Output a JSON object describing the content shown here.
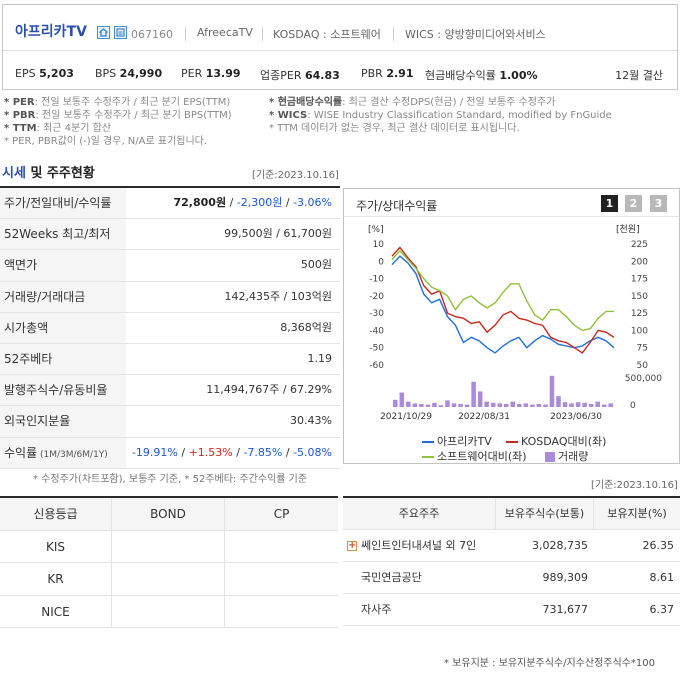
{
  "company": {
    "name": "아프리카TV",
    "code": "067160",
    "exchange_name": "AfreecaTV",
    "market": "KOSDAQ : 소프트웨어",
    "wics": "WICS : 양방향미디어와서비스"
  },
  "summary": {
    "stats": [
      {
        "label": "EPS",
        "value": "5,203"
      },
      {
        "label": "BPS",
        "value": "24,990"
      },
      {
        "label": "PER",
        "value": "13.99"
      },
      {
        "label": "업종PER",
        "value": "64.83"
      },
      {
        "label": "PBR",
        "value": "2.91"
      },
      {
        "label": "현금배당수익률",
        "value": "1.00%"
      }
    ],
    "settlement": "12월 결산"
  },
  "notes": [
    {
      "key": "* PER",
      "text": ": 전일 보통주 수정주가 / 최근 분기 EPS(TTM)"
    },
    {
      "key": "* PBR",
      "text": ": 전일 보통주 수정주가 / 최근 분기 BPS(TTM)"
    },
    {
      "key": "* TTM",
      "text": ": 최근 4분기 합산"
    },
    {
      "key": "",
      "text": "* PER, PBR값이 (-)일 경우, N/A로 표기됩니다."
    },
    {
      "key": "* 현금배당수익률",
      "text": ": 최근 결산 수정DPS(현금) / 전일 보통주 수정주가"
    },
    {
      "key": "* WICS",
      "text": ": WISE Industry Classification Standard, modified by FnGuide"
    },
    {
      "key": "",
      "text": "* TTM 데이터가 없는 경우, 최근 결산 데이터로 표시됩니다."
    }
  ],
  "market_section": {
    "title_blue": "시세",
    "title_rest": " 및 주주현황",
    "date": "[기준:2023.10.16]",
    "rows": [
      {
        "label": "주가/전일대비/수익률",
        "price": "72,800원",
        "sep1": " / ",
        "change": "-2,300원",
        "sep2": " / ",
        "rate": "-3.06%"
      },
      {
        "label": "52Weeks 최고/최저",
        "value": "99,500원 / 61,700원"
      },
      {
        "label": "액면가",
        "value": "500원"
      },
      {
        "label": "거래량/거래대금",
        "value": "142,435주 / 103억원"
      },
      {
        "label": "시가총액",
        "value": "8,368억원"
      },
      {
        "label": "52주베타",
        "value": "1.19"
      },
      {
        "label": "발행주식수/유동비율",
        "value": "11,494,767주 / 67.29%"
      },
      {
        "label": "외국인지분율",
        "value": "30.43%"
      }
    ],
    "returns": {
      "label": "수익률",
      "label_sub": " (1M/3M/6M/1Y)",
      "r1": "-19.91%",
      "r2": "+1.53%",
      "r3": "-7.85%",
      "r4": "-5.08%",
      "sep": " / "
    },
    "footnote": "* 수정주가(차트포함), 보통주 기준, * 52주베타: 주간수익률 기준"
  },
  "chart_panel": {
    "title": "주가/상대수익률",
    "buttons": [
      "1",
      "2",
      "3"
    ],
    "active_button": "1"
  },
  "chart_data": {
    "type": "line",
    "left_unit": "[%]",
    "right_unit": "[천원]",
    "y_left_ticks": [
      "10",
      "0",
      "-10",
      "-20",
      "-30",
      "-40",
      "-50",
      "-60"
    ],
    "ylim_left": [
      -60,
      10
    ],
    "y_right_ticks": [
      "225",
      "200",
      "175",
      "150",
      "125",
      "100",
      "75",
      "50"
    ],
    "ylim_right": [
      50,
      225
    ],
    "volume_ticks": [
      "500,000",
      "0"
    ],
    "x_ticks": [
      "2021/10/29",
      "2022/08/31",
      "2023/06/30"
    ],
    "series": [
      {
        "name": "아프리카TV",
        "color": "#1f6fd6",
        "values": [
          -2,
          3,
          -1,
          -7,
          -19,
          -24,
          -22,
          -32,
          -37,
          -47,
          -44,
          -46,
          -50,
          -53,
          -49,
          -46,
          -44,
          -50,
          -46,
          -43,
          -45,
          -48,
          -49,
          -50,
          -49,
          -46,
          -44,
          -46,
          -50
        ]
      },
      {
        "name": "KOSDAQ대비(좌)",
        "color": "#c8281c",
        "values": [
          3,
          8,
          2,
          -3,
          -14,
          -19,
          -17,
          -30,
          -32,
          -33,
          -36,
          -35,
          -41,
          -37,
          -31,
          -29,
          -33,
          -34,
          -36,
          -37,
          -44,
          -46,
          -47,
          -50,
          -53,
          -47,
          -40,
          -41,
          -44
        ]
      },
      {
        "name": "소프트웨어대비(좌)",
        "color": "#8ec13b",
        "values": [
          1,
          6,
          1,
          -4,
          -10,
          -15,
          -17,
          -20,
          -28,
          -22,
          -20,
          -24,
          -27,
          -24,
          -18,
          -13,
          -13,
          -23,
          -31,
          -34,
          -28,
          -28,
          -32,
          -37,
          -40,
          -39,
          -33,
          -29,
          -29
        ]
      }
    ],
    "volume": {
      "name": "거래량",
      "color": "#a98bd8",
      "values": [
        120000,
        240000,
        90000,
        60000,
        50000,
        40000,
        70000,
        30000,
        110000,
        60000,
        50000,
        40000,
        420000,
        260000,
        90000,
        70000,
        60000,
        50000,
        90000,
        50000,
        60000,
        40000,
        50000,
        40000,
        520000,
        180000,
        80000,
        60000,
        80000,
        70000,
        50000,
        90000,
        40000,
        60000
      ]
    }
  },
  "shareholders": {
    "date": "[기준:2023.10.16]",
    "headers": [
      "주요주주",
      "보유주식수(보통)",
      "보유지분(%)"
    ],
    "rows": [
      {
        "name": "쎄인트인터내셔널 외 7인",
        "shares": "3,028,735",
        "pct": "26.35",
        "expandable": true
      },
      {
        "name": "국민연금공단",
        "shares": "989,309",
        "pct": "8.61",
        "expandable": false
      },
      {
        "name": "자사주",
        "shares": "731,677",
        "pct": "6.37",
        "expandable": false
      }
    ],
    "footnote": "* 보유지분 : 보유지분주식수/지수산정주식수*100"
  },
  "credit": {
    "headers": [
      "신용등급",
      "BOND",
      "CP"
    ],
    "rows": [
      {
        "agency": "KIS",
        "bond": "",
        "cp": ""
      },
      {
        "agency": "KR",
        "bond": "",
        "cp": ""
      },
      {
        "agency": "NICE",
        "bond": "",
        "cp": ""
      }
    ]
  }
}
